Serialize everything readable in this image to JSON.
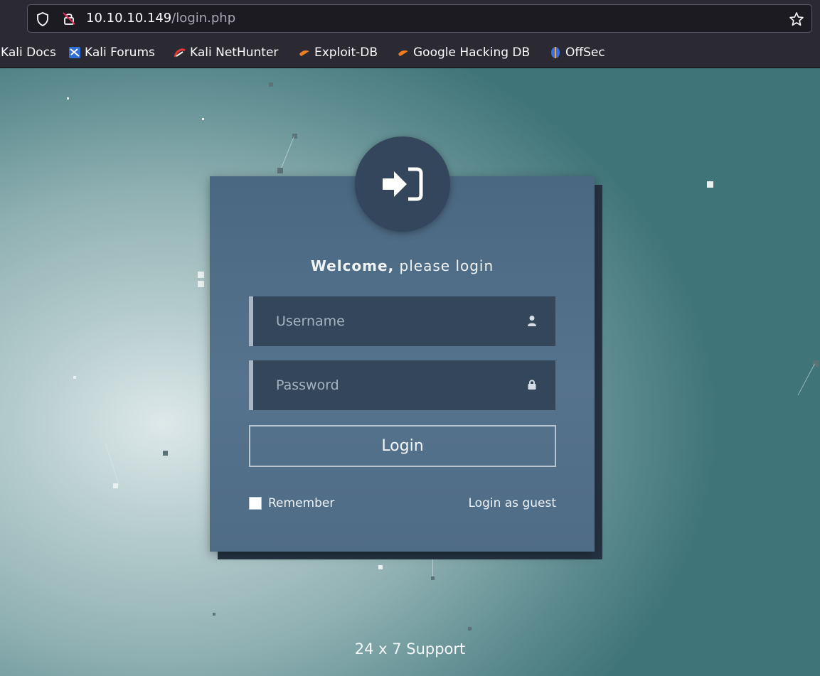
{
  "browser": {
    "url_host": "10.10.10.149",
    "url_path": "/login.php",
    "bookmarks": [
      {
        "label": "Kali Docs",
        "icon": "kali-docs-icon"
      },
      {
        "label": "Kali Forums",
        "icon": "kali-forums-icon"
      },
      {
        "label": "Kali NetHunter",
        "icon": "kali-nethunter-icon"
      },
      {
        "label": "Exploit-DB",
        "icon": "exploit-db-icon"
      },
      {
        "label": "Google Hacking DB",
        "icon": "google-hacking-db-icon"
      },
      {
        "label": "OffSec",
        "icon": "offsec-icon"
      }
    ]
  },
  "login": {
    "welcome_bold": "Welcome,",
    "welcome_rest": " please login",
    "username_placeholder": "Username",
    "password_placeholder": "Password",
    "login_label": "Login",
    "remember_label": "Remember",
    "guest_label": "Login as guest"
  },
  "footer": {
    "support": "24 x 7 Support"
  },
  "colors": {
    "card": "#4f6c86",
    "field_bg": "#34465a",
    "badge": "#33465b",
    "page_accent": "#3f7478"
  }
}
